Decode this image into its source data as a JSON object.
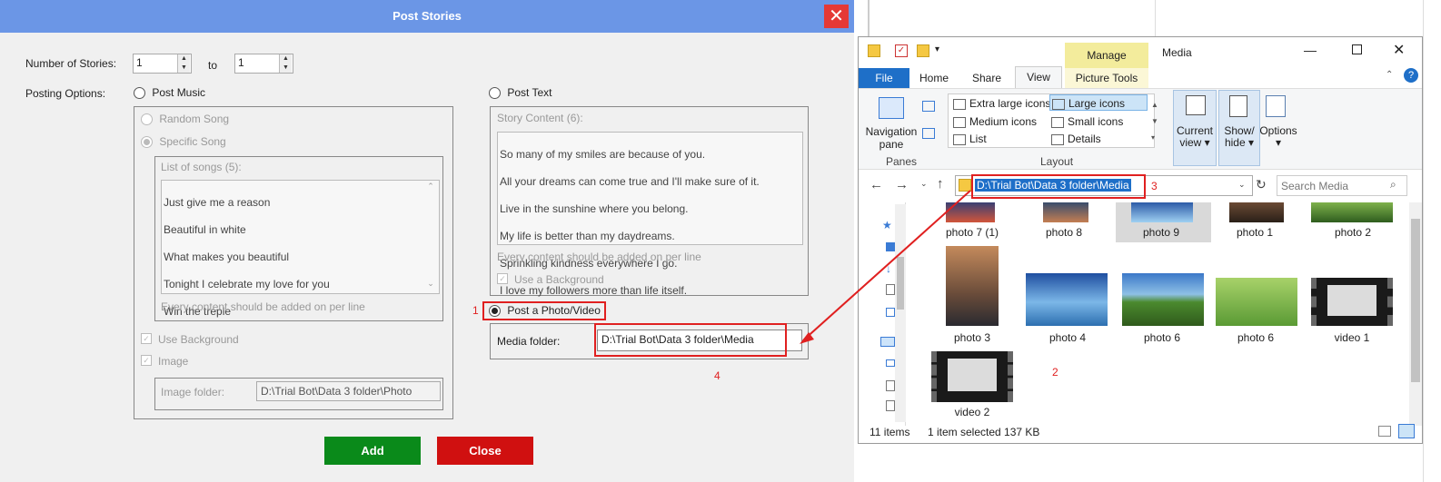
{
  "dialog": {
    "title": "Post Stories",
    "close_glyph": "✕",
    "number_of_stories_label": "Number of Stories:",
    "from_value": "1",
    "to_label": "to",
    "to_value": "1",
    "posting_options_label": "Posting Options:",
    "post_music_label": "Post Music",
    "random_song_label": "Random Song",
    "specific_song_label": "Specific Song",
    "list_of_songs_label": "List of songs (5):",
    "songs": [
      "Just give me a reason",
      "Beautiful in white",
      "What makes you beautiful",
      "Tonight I celebrate my love for you",
      "Win the treple"
    ],
    "songs_hint": "Every content should be added on per line",
    "use_background_label": "Use Background",
    "image_label": "Image",
    "image_folder_label": "Image folder:",
    "image_folder_value": "D:\\Trial Bot\\Data 3 folder\\Photo",
    "post_text_label": "Post Text",
    "story_content_label": "Story Content (6):",
    "story_lines": [
      "So many of my smiles are because of you.",
      "All your dreams can come true and I'll make sure of it.",
      "Live in the sunshine where you belong.",
      "My life is better than my daydreams.",
      "Sprinkling kindness everywhere I go.",
      "I love my followers more than life itself."
    ],
    "story_hint": "Every content should be added on per line",
    "text_use_background_label": "Use a Background",
    "post_photo_label": "Post a Photo/Video",
    "media_folder_label": "Media folder:",
    "media_folder_value": "D:\\Trial Bot\\Data 3 folder\\Media",
    "add_label": "Add",
    "close_label": "Close"
  },
  "annotations": {
    "a1": "1",
    "a2": "2",
    "a3": "3",
    "a4": "4"
  },
  "explorer": {
    "manage_tab": "Manage",
    "window_title": "Media",
    "tabs": [
      "File",
      "Home",
      "Share",
      "View",
      "Picture Tools"
    ],
    "nav_pane_label": "Navigation pane",
    "layout_options": [
      "Extra large icons",
      "Large icons",
      "Medium icons",
      "Small icons",
      "List",
      "Details"
    ],
    "panes_group": "Panes",
    "layout_group": "Layout",
    "current_view_label": "Current view",
    "show_hide_label": "Show/ hide",
    "options_label": "Options",
    "address": "D:\\Trial Bot\\Data 3 folder\\Media",
    "search_placeholder": "Search Media",
    "files_row1": [
      "photo  7 (1)",
      "photo  8",
      "photo  9",
      "photo 1",
      "photo 2"
    ],
    "files_row2": [
      "photo 3",
      "photo 4",
      "photo 6",
      "photo 6",
      "video 1"
    ],
    "files_row3": [
      "video 2"
    ],
    "status_items": "11 items",
    "status_selected": "1 item selected  137 KB"
  },
  "colors": {
    "title_bar": "#6b96e6",
    "add_button": "#0a8a1a",
    "close_button": "#d01010",
    "annotation_red": "#e02020",
    "file_tab": "#1e6fc8",
    "manage_tab": "#f3ec9c"
  }
}
